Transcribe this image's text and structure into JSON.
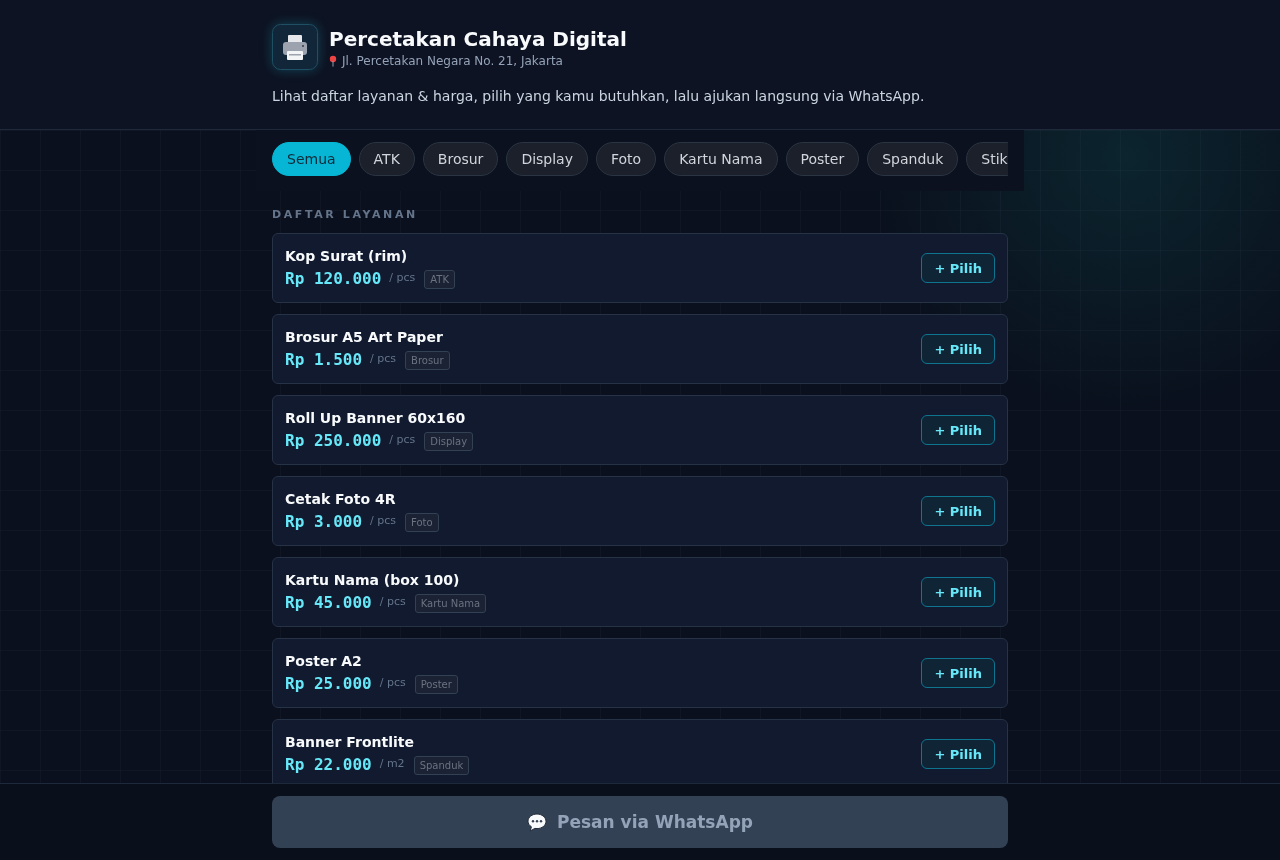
{
  "header": {
    "title": "Percetakan Cahaya Digital",
    "address": "Jl. Percetakan Negara No. 21, Jakarta",
    "description": "Lihat daftar layanan & harga, pilih yang kamu butuhkan, lalu ajukan langsung via WhatsApp."
  },
  "filters": [
    {
      "label": "Semua",
      "selected": true
    },
    {
      "label": "ATK",
      "selected": false
    },
    {
      "label": "Brosur",
      "selected": false
    },
    {
      "label": "Display",
      "selected": false
    },
    {
      "label": "Foto",
      "selected": false
    },
    {
      "label": "Kartu Nama",
      "selected": false
    },
    {
      "label": "Poster",
      "selected": false
    },
    {
      "label": "Spanduk",
      "selected": false
    },
    {
      "label": "Stik",
      "selected": false
    }
  ],
  "section_title": "DAFTAR LAYANAN",
  "services": [
    {
      "name": "Kop Surat (rim)",
      "price": "Rp 120.000",
      "unit": "/ pcs",
      "category": "ATK",
      "button": "+ Pilih"
    },
    {
      "name": "Brosur A5 Art Paper",
      "price": "Rp 1.500",
      "unit": "/ pcs",
      "category": "Brosur",
      "button": "+ Pilih"
    },
    {
      "name": "Roll Up Banner 60x160",
      "price": "Rp 250.000",
      "unit": "/ pcs",
      "category": "Display",
      "button": "+ Pilih"
    },
    {
      "name": "Cetak Foto 4R",
      "price": "Rp 3.000",
      "unit": "/ pcs",
      "category": "Foto",
      "button": "+ Pilih"
    },
    {
      "name": "Kartu Nama (box 100)",
      "price": "Rp 45.000",
      "unit": "/ pcs",
      "category": "Kartu Nama",
      "button": "+ Pilih"
    },
    {
      "name": "Poster A2",
      "price": "Rp 25.000",
      "unit": "/ pcs",
      "category": "Poster",
      "button": "+ Pilih"
    },
    {
      "name": "Banner Frontlite",
      "price": "Rp 22.000",
      "unit": "/ m2",
      "category": "Spanduk",
      "button": "+ Pilih"
    }
  ],
  "order_button": {
    "label": "Pesan via WhatsApp",
    "disabled": true
  }
}
